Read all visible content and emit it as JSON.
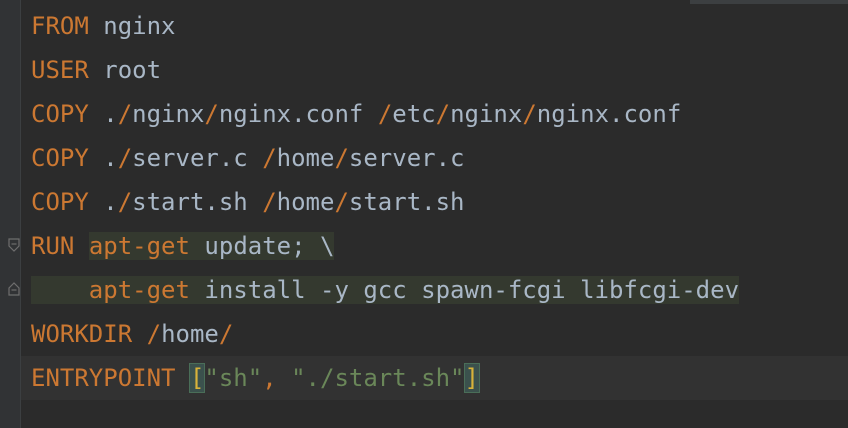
{
  "editor": {
    "language": "Dockerfile",
    "colors": {
      "background": "#2b2b2b",
      "keyword": "#cc7832",
      "text": "#a9b7c6",
      "string": "#6a8759",
      "highlight": "#34392f"
    },
    "lines": [
      {
        "segments": [
          {
            "t": "FROM",
            "c": "kw"
          },
          {
            "t": " nginx",
            "c": "txt"
          }
        ]
      },
      {
        "segments": [
          {
            "t": "USER",
            "c": "kw"
          },
          {
            "t": " root",
            "c": "txt"
          }
        ]
      },
      {
        "segments": [
          {
            "t": "COPY",
            "c": "kw"
          },
          {
            "t": " .",
            "c": "txt"
          },
          {
            "t": "/",
            "c": "sep"
          },
          {
            "t": "nginx",
            "c": "txt"
          },
          {
            "t": "/",
            "c": "sep"
          },
          {
            "t": "nginx.conf ",
            "c": "txt"
          },
          {
            "t": "/",
            "c": "sep"
          },
          {
            "t": "etc",
            "c": "txt"
          },
          {
            "t": "/",
            "c": "sep"
          },
          {
            "t": "nginx",
            "c": "txt"
          },
          {
            "t": "/",
            "c": "sep"
          },
          {
            "t": "nginx.conf",
            "c": "txt"
          }
        ]
      },
      {
        "segments": [
          {
            "t": "COPY",
            "c": "kw"
          },
          {
            "t": " .",
            "c": "txt"
          },
          {
            "t": "/",
            "c": "sep"
          },
          {
            "t": "server.c ",
            "c": "txt"
          },
          {
            "t": "/",
            "c": "sep"
          },
          {
            "t": "home",
            "c": "txt"
          },
          {
            "t": "/",
            "c": "sep"
          },
          {
            "t": "server.c",
            "c": "txt"
          }
        ]
      },
      {
        "segments": [
          {
            "t": "COPY",
            "c": "kw"
          },
          {
            "t": " .",
            "c": "txt"
          },
          {
            "t": "/",
            "c": "sep"
          },
          {
            "t": "start.sh ",
            "c": "txt"
          },
          {
            "t": "/",
            "c": "sep"
          },
          {
            "t": "home",
            "c": "txt"
          },
          {
            "t": "/",
            "c": "sep"
          },
          {
            "t": "start.sh",
            "c": "txt"
          }
        ]
      },
      {
        "fold": "start",
        "segments": [
          {
            "t": "RUN",
            "c": "kw"
          },
          {
            "t": " ",
            "c": "txt"
          },
          {
            "t": "apt-get",
            "c": "kw",
            "hl": true
          },
          {
            "t": " update; \\",
            "c": "txt",
            "hl": true
          }
        ]
      },
      {
        "fold": "end",
        "segments": [
          {
            "t": "    ",
            "c": "txt",
            "hl": true
          },
          {
            "t": "apt-get",
            "c": "kw",
            "hl": true
          },
          {
            "t": " install -y gcc spawn-fcgi libfcgi-dev",
            "c": "txt",
            "hl": true
          }
        ]
      },
      {
        "segments": [
          {
            "t": "WORKDIR",
            "c": "kw"
          },
          {
            "t": " ",
            "c": "txt"
          },
          {
            "t": "/",
            "c": "sep"
          },
          {
            "t": "home",
            "c": "txt"
          },
          {
            "t": "/",
            "c": "sep"
          }
        ]
      },
      {
        "segments": [
          {
            "t": "ENTRYPOINT",
            "c": "kw"
          },
          {
            "t": " ",
            "c": "txt"
          },
          {
            "t": "[",
            "c": "bracket"
          },
          {
            "t": "\"sh\"",
            "c": "str"
          },
          {
            "t": ", ",
            "c": "sep"
          },
          {
            "t": "\"./start.sh\"",
            "c": "str"
          },
          {
            "t": "]",
            "c": "bracket"
          }
        ]
      }
    ]
  }
}
